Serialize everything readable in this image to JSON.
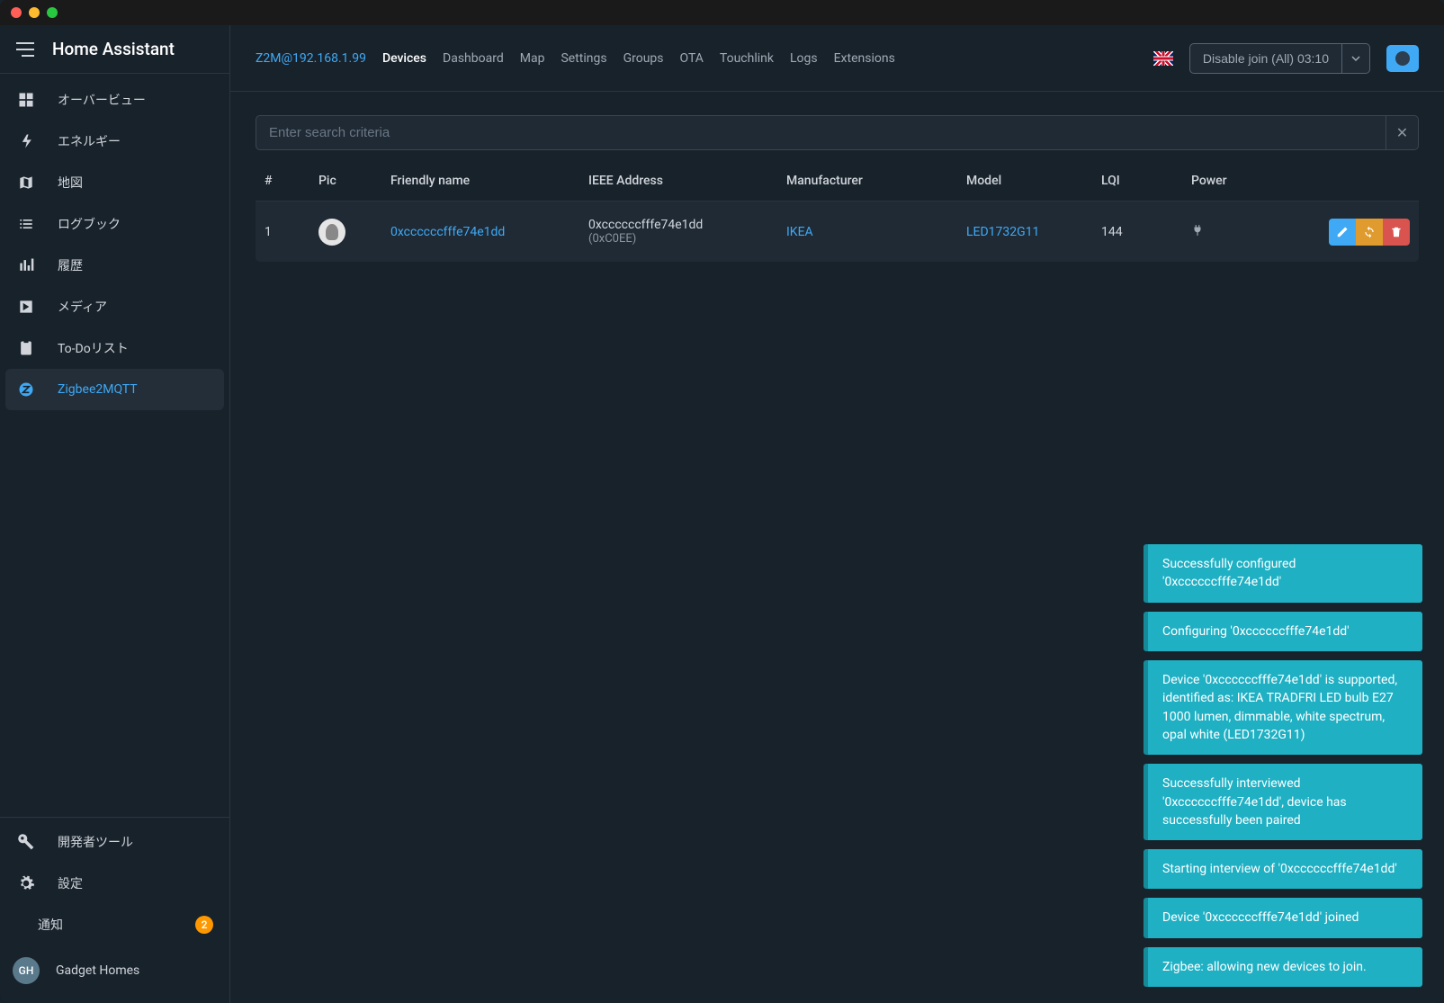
{
  "app_title": "Home Assistant",
  "sidebar": {
    "items": [
      {
        "label": "オーバービュー"
      },
      {
        "label": "エネルギー"
      },
      {
        "label": "地図"
      },
      {
        "label": "ログブック"
      },
      {
        "label": "履歴"
      },
      {
        "label": "メディア"
      },
      {
        "label": "To-Doリスト"
      },
      {
        "label": "Zigbee2MQTT"
      }
    ],
    "dev_tools": "開発者ツール",
    "settings": "設定",
    "notifications": "通知",
    "notifications_count": "2",
    "user_initials": "GH",
    "user_name": "Gadget Homes"
  },
  "topbar": {
    "z2m_link": "Z2M@192.168.1.99",
    "tabs": [
      "Devices",
      "Dashboard",
      "Map",
      "Settings",
      "Groups",
      "OTA",
      "Touchlink",
      "Logs",
      "Extensions"
    ],
    "join_label": "Disable join (All) 03:10"
  },
  "content": {
    "search_placeholder": "Enter search criteria",
    "columns": {
      "num": "#",
      "pic": "Pic",
      "friendly": "Friendly name",
      "ieee": "IEEE Address",
      "manufacturer": "Manufacturer",
      "model": "Model",
      "lqi": "LQI",
      "power": "Power"
    },
    "rows": [
      {
        "num": "1",
        "friendly": "0xccccccfffe74e1dd",
        "ieee": "0xccccccfffe74e1dd",
        "ieee_short": "(0xC0EE)",
        "manufacturer": "IKEA",
        "model": "LED1732G11",
        "lqi": "144"
      }
    ]
  },
  "toasts": [
    "Successfully configured '0xccccccfffe74e1dd'",
    "Configuring '0xccccccfffe74e1dd'",
    "Device '0xccccccfffe74e1dd' is supported, identified as: IKEA TRADFRI LED bulb E27 1000 lumen, dimmable, white spectrum, opal white (LED1732G11)",
    "Successfully interviewed '0xccccccfffe74e1dd', device has successfully been paired",
    "Starting interview of '0xccccccfffe74e1dd'",
    "Device '0xccccccfffe74e1dd' joined",
    "Zigbee: allowing new devices to join."
  ]
}
